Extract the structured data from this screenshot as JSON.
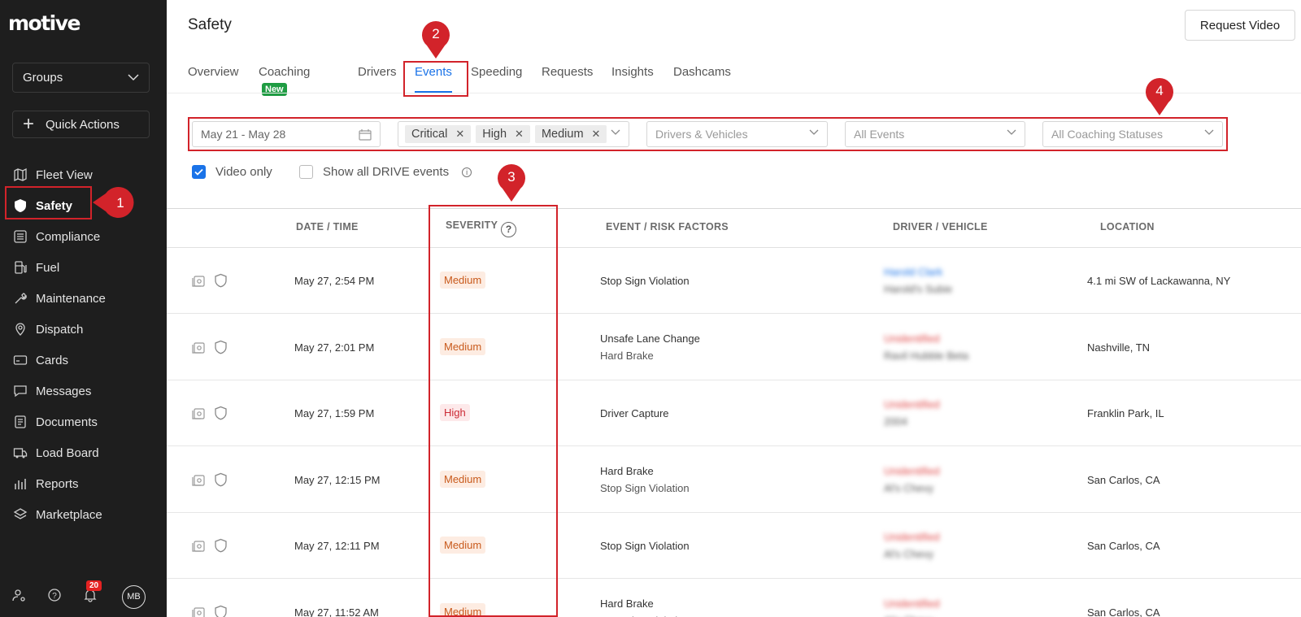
{
  "brand": "motive",
  "sidebar": {
    "groups_label": "Groups",
    "quick_actions_label": "Quick Actions",
    "items": [
      {
        "label": "Fleet View",
        "icon": "map-icon"
      },
      {
        "label": "Safety",
        "icon": "shield-icon"
      },
      {
        "label": "Compliance",
        "icon": "list-icon"
      },
      {
        "label": "Fuel",
        "icon": "fuel-pump-icon"
      },
      {
        "label": "Maintenance",
        "icon": "wrench-icon"
      },
      {
        "label": "Dispatch",
        "icon": "location-pin-icon"
      },
      {
        "label": "Cards",
        "icon": "card-icon"
      },
      {
        "label": "Messages",
        "icon": "chat-icon"
      },
      {
        "label": "Documents",
        "icon": "document-icon"
      },
      {
        "label": "Load Board",
        "icon": "truck-icon"
      },
      {
        "label": "Reports",
        "icon": "bar-chart-icon"
      },
      {
        "label": "Marketplace",
        "icon": "layers-icon"
      }
    ],
    "active_item": "Safety",
    "notification_count": "20",
    "avatar_initials": "MB"
  },
  "header": {
    "title": "Safety",
    "request_video_label": "Request Video",
    "tabs": [
      {
        "label": "Overview"
      },
      {
        "label": "Coaching",
        "badge": "New"
      },
      {
        "label": "Drivers"
      },
      {
        "label": "Events"
      },
      {
        "label": "Speeding"
      },
      {
        "label": "Requests"
      },
      {
        "label": "Insights"
      },
      {
        "label": "Dashcams"
      }
    ],
    "active_tab": "Events"
  },
  "filters": {
    "date_range": "May 21 - May 28",
    "severity_chips": [
      "Critical",
      "High",
      "Medium"
    ],
    "drivers_placeholder": "Drivers & Vehicles",
    "events_placeholder": "All Events",
    "coaching_placeholder": "All Coaching Statuses",
    "video_only_label": "Video only",
    "video_only_checked": true,
    "show_drive_label": "Show all DRIVE events",
    "show_drive_checked": false
  },
  "table": {
    "columns": [
      "DATE / TIME",
      "SEVERITY",
      "EVENT / RISK FACTORS",
      "DRIVER / VEHICLE",
      "LOCATION"
    ],
    "rows": [
      {
        "datetime": "May 27, 2:54 PM",
        "severity": "Medium",
        "event": "Stop Sign Violation",
        "factor": "",
        "driver": "Harold Clark",
        "vehicle": "Harold's Subie",
        "location": "4.1 mi SW of Lackawanna, NY"
      },
      {
        "datetime": "May 27, 2:01 PM",
        "severity": "Medium",
        "event": "Unsafe Lane Change",
        "factor": "Hard Brake",
        "driver": "Unidentified",
        "vehicle": "Ravil Hubble Beta",
        "location": "Nashville, TN"
      },
      {
        "datetime": "May 27, 1:59 PM",
        "severity": "High",
        "event": "Driver Capture",
        "factor": "",
        "driver": "Unidentified",
        "vehicle": "2004",
        "location": "Franklin Park, IL"
      },
      {
        "datetime": "May 27, 12:15 PM",
        "severity": "Medium",
        "event": "Hard Brake",
        "factor": "Stop Sign Violation",
        "driver": "Unidentified",
        "vehicle": "Al's Chevy",
        "location": "San Carlos, CA"
      },
      {
        "datetime": "May 27, 12:11 PM",
        "severity": "Medium",
        "event": "Stop Sign Violation",
        "factor": "",
        "driver": "Unidentified",
        "vehicle": "Al's Chevy",
        "location": "San Carlos, CA"
      },
      {
        "datetime": "May 27, 11:52 AM",
        "severity": "Medium",
        "event": "Hard Brake",
        "factor": "Stop Sign Violation",
        "driver": "Unidentified",
        "vehicle": "Al's Chevy",
        "location": "San Carlos, CA"
      }
    ]
  },
  "annotations": [
    "1",
    "2",
    "3",
    "4"
  ],
  "colors": {
    "sidebar_bg": "#1e1e1e",
    "accent_blue": "#1a73e8",
    "annotation_red": "#d2232a",
    "severity_medium": "#c85a1c",
    "severity_high": "#cc2a35",
    "new_badge": "#1f9c43"
  }
}
